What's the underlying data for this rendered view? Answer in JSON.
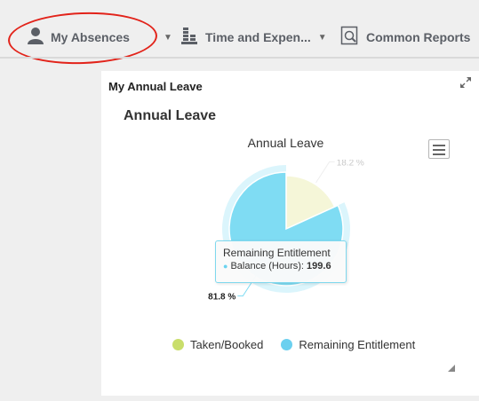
{
  "nav": {
    "items": [
      {
        "label": "My Absences",
        "icon": "person-icon"
      },
      {
        "label": "Time and Expen...",
        "icon": "coins-icon"
      },
      {
        "label": "Common Reports",
        "icon": "report-icon"
      }
    ],
    "highlight_color": "#e2231a"
  },
  "portlet": {
    "title": "My Annual Leave",
    "section_title": "Annual Leave"
  },
  "chart_data": {
    "type": "pie",
    "title": "Annual Leave",
    "slices": [
      {
        "name": "Taken/Booked",
        "percent": 18.2,
        "label": "18.2 %",
        "color": "#f5f6d8",
        "legend_color": "#c9de6b"
      },
      {
        "name": "Remaining Entitlement",
        "percent": 81.8,
        "label": "81.8 %",
        "color": "#7fdcf3",
        "legend_color": "#6bd0ef",
        "hovered": true
      }
    ],
    "legend": [
      "Taken/Booked",
      "Remaining Entitlement"
    ],
    "legend_position": "bottom-center",
    "tooltip": {
      "header": "Remaining Entitlement",
      "series_label": "Balance (Hours)",
      "value": "199.6"
    }
  }
}
